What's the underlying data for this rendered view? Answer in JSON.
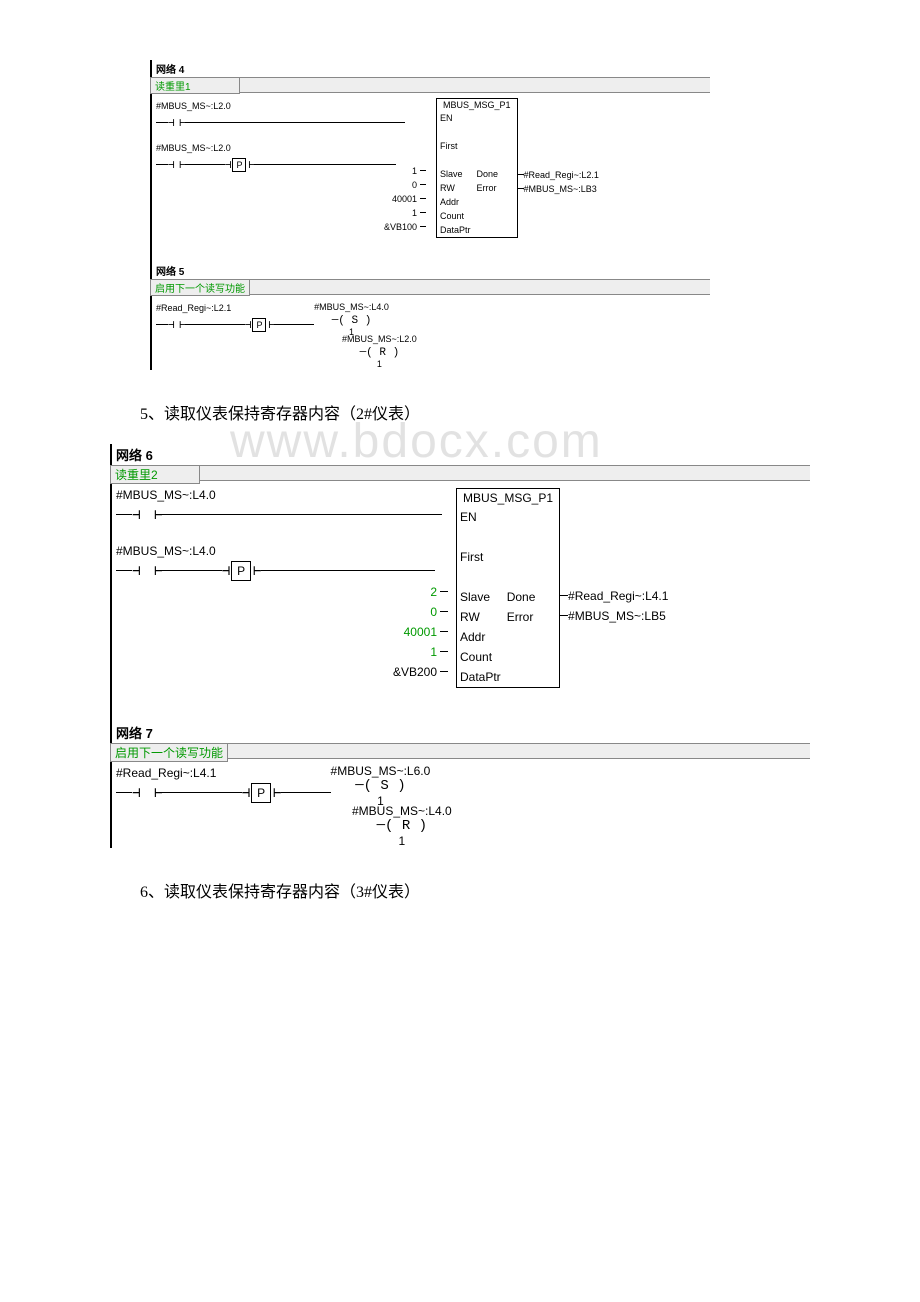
{
  "watermark": "www.bdocx.com",
  "figure1": {
    "net4": {
      "label": "网络 4",
      "title": "读重里1",
      "contact1": "#MBUS_MS~:L2.0",
      "contact2": "#MBUS_MS~:L2.0",
      "p": "P",
      "block_name": "MBUS_MSG_P1",
      "en": "EN",
      "first": "First",
      "slave_lbl": "Slave",
      "slave_val": "1",
      "rw_lbl": "RW",
      "rw_val": "0",
      "addr_lbl": "Addr",
      "addr_val": "40001",
      "count_lbl": "Count",
      "count_val": "1",
      "dptr_lbl": "DataPtr",
      "dptr_val": "&VB100",
      "done_lbl": "Done",
      "done_val": "#Read_Regi~:L2.1",
      "error_lbl": "Error",
      "error_val": "#MBUS_MS~:LB3"
    },
    "net5": {
      "label": "网络 5",
      "title": "启用下一个读写功能",
      "contact1": "#Read_Regi~:L2.1",
      "p": "P",
      "s_tag": "#MBUS_MS~:L4.0",
      "s_coil": "S",
      "s_num": "1",
      "r_tag": "#MBUS_MS~:L2.0",
      "r_coil": "R",
      "r_num": "1"
    }
  },
  "caption1": "5、读取仪表保持寄存器内容（2#仪表）",
  "figure2": {
    "net6": {
      "label": "网络 6",
      "title": "读重里2",
      "contact1": "#MBUS_MS~:L4.0",
      "contact2": "#MBUS_MS~:L4.0",
      "p": "P",
      "block_name": "MBUS_MSG_P1",
      "en": "EN",
      "first": "First",
      "slave_lbl": "Slave",
      "slave_val": "2",
      "rw_lbl": "RW",
      "rw_val": "0",
      "addr_lbl": "Addr",
      "addr_val": "40001",
      "count_lbl": "Count",
      "count_val": "1",
      "dptr_lbl": "DataPtr",
      "dptr_val": "&VB200",
      "done_lbl": "Done",
      "done_val": "#Read_Regi~:L4.1",
      "error_lbl": "Error",
      "error_val": "#MBUS_MS~:LB5"
    },
    "net7": {
      "label": "网络 7",
      "title": "启用下一个读写功能",
      "contact1": "#Read_Regi~:L4.1",
      "p": "P",
      "s_tag": "#MBUS_MS~:L6.0",
      "s_coil": "S",
      "s_num": "1",
      "r_tag": "#MBUS_MS~:L4.0",
      "r_coil": "R",
      "r_num": "1"
    }
  },
  "caption2": "6、读取仪表保持寄存器内容（3#仪表）"
}
